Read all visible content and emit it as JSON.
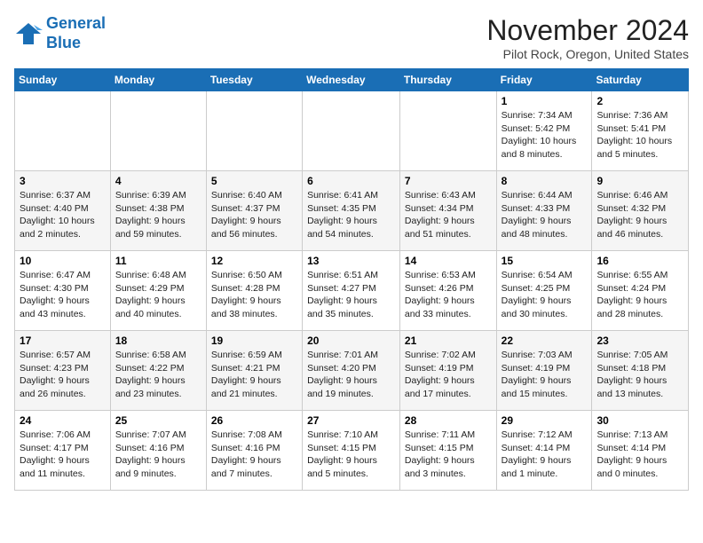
{
  "header": {
    "logo_line1": "General",
    "logo_line2": "Blue",
    "month_title": "November 2024",
    "location": "Pilot Rock, Oregon, United States"
  },
  "weekdays": [
    "Sunday",
    "Monday",
    "Tuesday",
    "Wednesday",
    "Thursday",
    "Friday",
    "Saturday"
  ],
  "weeks": [
    [
      {
        "day": "",
        "info": ""
      },
      {
        "day": "",
        "info": ""
      },
      {
        "day": "",
        "info": ""
      },
      {
        "day": "",
        "info": ""
      },
      {
        "day": "",
        "info": ""
      },
      {
        "day": "1",
        "info": "Sunrise: 7:34 AM\nSunset: 5:42 PM\nDaylight: 10 hours and 8 minutes."
      },
      {
        "day": "2",
        "info": "Sunrise: 7:36 AM\nSunset: 5:41 PM\nDaylight: 10 hours and 5 minutes."
      }
    ],
    [
      {
        "day": "3",
        "info": "Sunrise: 6:37 AM\nSunset: 4:40 PM\nDaylight: 10 hours and 2 minutes."
      },
      {
        "day": "4",
        "info": "Sunrise: 6:39 AM\nSunset: 4:38 PM\nDaylight: 9 hours and 59 minutes."
      },
      {
        "day": "5",
        "info": "Sunrise: 6:40 AM\nSunset: 4:37 PM\nDaylight: 9 hours and 56 minutes."
      },
      {
        "day": "6",
        "info": "Sunrise: 6:41 AM\nSunset: 4:35 PM\nDaylight: 9 hours and 54 minutes."
      },
      {
        "day": "7",
        "info": "Sunrise: 6:43 AM\nSunset: 4:34 PM\nDaylight: 9 hours and 51 minutes."
      },
      {
        "day": "8",
        "info": "Sunrise: 6:44 AM\nSunset: 4:33 PM\nDaylight: 9 hours and 48 minutes."
      },
      {
        "day": "9",
        "info": "Sunrise: 6:46 AM\nSunset: 4:32 PM\nDaylight: 9 hours and 46 minutes."
      }
    ],
    [
      {
        "day": "10",
        "info": "Sunrise: 6:47 AM\nSunset: 4:30 PM\nDaylight: 9 hours and 43 minutes."
      },
      {
        "day": "11",
        "info": "Sunrise: 6:48 AM\nSunset: 4:29 PM\nDaylight: 9 hours and 40 minutes."
      },
      {
        "day": "12",
        "info": "Sunrise: 6:50 AM\nSunset: 4:28 PM\nDaylight: 9 hours and 38 minutes."
      },
      {
        "day": "13",
        "info": "Sunrise: 6:51 AM\nSunset: 4:27 PM\nDaylight: 9 hours and 35 minutes."
      },
      {
        "day": "14",
        "info": "Sunrise: 6:53 AM\nSunset: 4:26 PM\nDaylight: 9 hours and 33 minutes."
      },
      {
        "day": "15",
        "info": "Sunrise: 6:54 AM\nSunset: 4:25 PM\nDaylight: 9 hours and 30 minutes."
      },
      {
        "day": "16",
        "info": "Sunrise: 6:55 AM\nSunset: 4:24 PM\nDaylight: 9 hours and 28 minutes."
      }
    ],
    [
      {
        "day": "17",
        "info": "Sunrise: 6:57 AM\nSunset: 4:23 PM\nDaylight: 9 hours and 26 minutes."
      },
      {
        "day": "18",
        "info": "Sunrise: 6:58 AM\nSunset: 4:22 PM\nDaylight: 9 hours and 23 minutes."
      },
      {
        "day": "19",
        "info": "Sunrise: 6:59 AM\nSunset: 4:21 PM\nDaylight: 9 hours and 21 minutes."
      },
      {
        "day": "20",
        "info": "Sunrise: 7:01 AM\nSunset: 4:20 PM\nDaylight: 9 hours and 19 minutes."
      },
      {
        "day": "21",
        "info": "Sunrise: 7:02 AM\nSunset: 4:19 PM\nDaylight: 9 hours and 17 minutes."
      },
      {
        "day": "22",
        "info": "Sunrise: 7:03 AM\nSunset: 4:19 PM\nDaylight: 9 hours and 15 minutes."
      },
      {
        "day": "23",
        "info": "Sunrise: 7:05 AM\nSunset: 4:18 PM\nDaylight: 9 hours and 13 minutes."
      }
    ],
    [
      {
        "day": "24",
        "info": "Sunrise: 7:06 AM\nSunset: 4:17 PM\nDaylight: 9 hours and 11 minutes."
      },
      {
        "day": "25",
        "info": "Sunrise: 7:07 AM\nSunset: 4:16 PM\nDaylight: 9 hours and 9 minutes."
      },
      {
        "day": "26",
        "info": "Sunrise: 7:08 AM\nSunset: 4:16 PM\nDaylight: 9 hours and 7 minutes."
      },
      {
        "day": "27",
        "info": "Sunrise: 7:10 AM\nSunset: 4:15 PM\nDaylight: 9 hours and 5 minutes."
      },
      {
        "day": "28",
        "info": "Sunrise: 7:11 AM\nSunset: 4:15 PM\nDaylight: 9 hours and 3 minutes."
      },
      {
        "day": "29",
        "info": "Sunrise: 7:12 AM\nSunset: 4:14 PM\nDaylight: 9 hours and 1 minute."
      },
      {
        "day": "30",
        "info": "Sunrise: 7:13 AM\nSunset: 4:14 PM\nDaylight: 9 hours and 0 minutes."
      }
    ]
  ]
}
